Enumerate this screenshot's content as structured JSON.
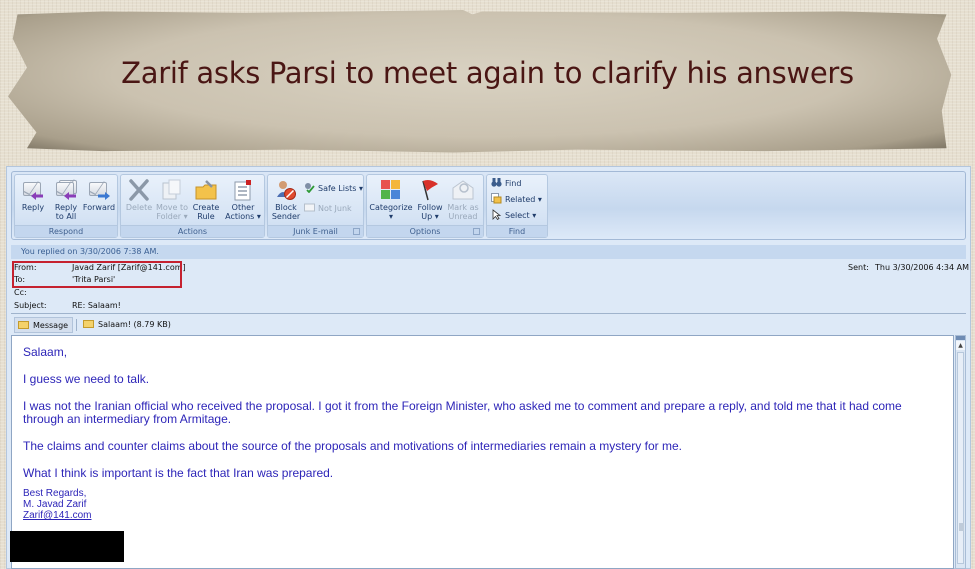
{
  "banner": {
    "title": "Zarif asks Parsi to meet again to clarify his answers"
  },
  "ribbon": {
    "groups": [
      {
        "label": "Respond",
        "buttons": [
          {
            "label_line1": "Reply",
            "label_line2": "",
            "icon": "reply-icon",
            "enabled": true
          },
          {
            "label_line1": "Reply",
            "label_line2": "to All",
            "icon": "reply-all-icon",
            "enabled": true
          },
          {
            "label_line1": "Forward",
            "label_line2": "",
            "icon": "forward-icon",
            "enabled": true
          }
        ]
      },
      {
        "label": "Actions",
        "buttons": [
          {
            "label_line1": "Delete",
            "label_line2": "",
            "icon": "delete-icon",
            "enabled": false
          },
          {
            "label_line1": "Move to",
            "label_line2": "Folder ▾",
            "icon": "move-to-folder-icon",
            "enabled": false
          },
          {
            "label_line1": "Create",
            "label_line2": "Rule",
            "icon": "create-rule-icon",
            "enabled": true
          },
          {
            "label_line1": "Other",
            "label_line2": "Actions ▾",
            "icon": "other-actions-icon",
            "enabled": true
          }
        ]
      },
      {
        "label": "Junk E-mail",
        "buttons": [
          {
            "label_line1": "Block",
            "label_line2": "Sender",
            "icon": "block-sender-icon",
            "enabled": true
          }
        ],
        "small_buttons": [
          {
            "label": "Safe Lists ▾",
            "icon": "safe-lists-icon",
            "enabled": true
          },
          {
            "label": "Not Junk",
            "icon": "not-junk-icon",
            "enabled": false
          }
        ]
      },
      {
        "label": "Options",
        "buttons": [
          {
            "label_line1": "Categorize",
            "label_line2": "▾",
            "icon": "categorize-icon",
            "enabled": true
          },
          {
            "label_line1": "Follow",
            "label_line2": "Up ▾",
            "icon": "follow-up-flag-icon",
            "enabled": true
          },
          {
            "label_line1": "Mark as",
            "label_line2": "Unread",
            "icon": "mark-unread-icon",
            "enabled": false
          }
        ]
      },
      {
        "label": "Find",
        "small_buttons": [
          {
            "label": "Find",
            "icon": "binoculars-icon",
            "enabled": true
          },
          {
            "label": "Related ▾",
            "icon": "related-icon",
            "enabled": true
          },
          {
            "label": "Select ▾",
            "icon": "select-cursor-icon",
            "enabled": true
          }
        ]
      }
    ]
  },
  "message": {
    "infobar": "You replied on 3/30/2006 7:38 AM.",
    "from_label": "From:",
    "from_value": "Javad Zarif [Zarif@141.com]",
    "to_label": "To:",
    "to_value": "'Trita Parsi'",
    "cc_label": "Cc:",
    "cc_value": "",
    "subject_label": "Subject:",
    "subject_value": "RE: Salaam!",
    "sent_label": "Sent:",
    "sent_value": "Thu 3/30/2006 4:34 AM",
    "tabs": [
      {
        "label": "Message"
      },
      {
        "label": "Salaam! (8.79 KB)"
      }
    ],
    "body": [
      "Salaam,",
      "I guess we need to talk.",
      "I was not the Iranian official who received the proposal.  I got it from the Foreign Minister, who asked me to comment and prepare a reply, and told me that it had come through an intermediary from Armitage.",
      "The claims and counter claims about the source of the proposals and motivations of intermediaries remain a mystery for me.",
      "What I think is important is the fact that Iran was prepared."
    ],
    "signature": {
      "closing": "Best Regards,",
      "name": "M. Javad Zarif",
      "email": "Zarif@141.com"
    }
  },
  "colors": {
    "title_text": "#4a1614",
    "body_text": "#2d25b8",
    "highlight_box": "#c5212f"
  }
}
